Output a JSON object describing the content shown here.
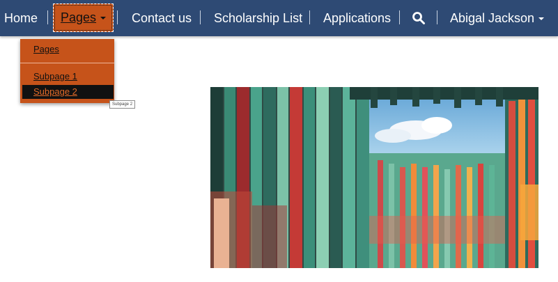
{
  "nav": {
    "home": "Home",
    "pages": "Pages",
    "contact": "Contact us",
    "scholarships": "Scholarship List",
    "applications": "Applications",
    "search_icon": "search-icon",
    "user": "Abigal Jackson"
  },
  "dropdown": {
    "items": [
      {
        "label": "Pages"
      },
      {
        "label": "Subpage 1"
      },
      {
        "label": "Subpage 2",
        "active": true
      }
    ]
  },
  "tooltip": "Subpage 2",
  "colors": {
    "navbar": "#2e4a74",
    "accent": "#c6531a",
    "active_item_bg": "#111111"
  }
}
